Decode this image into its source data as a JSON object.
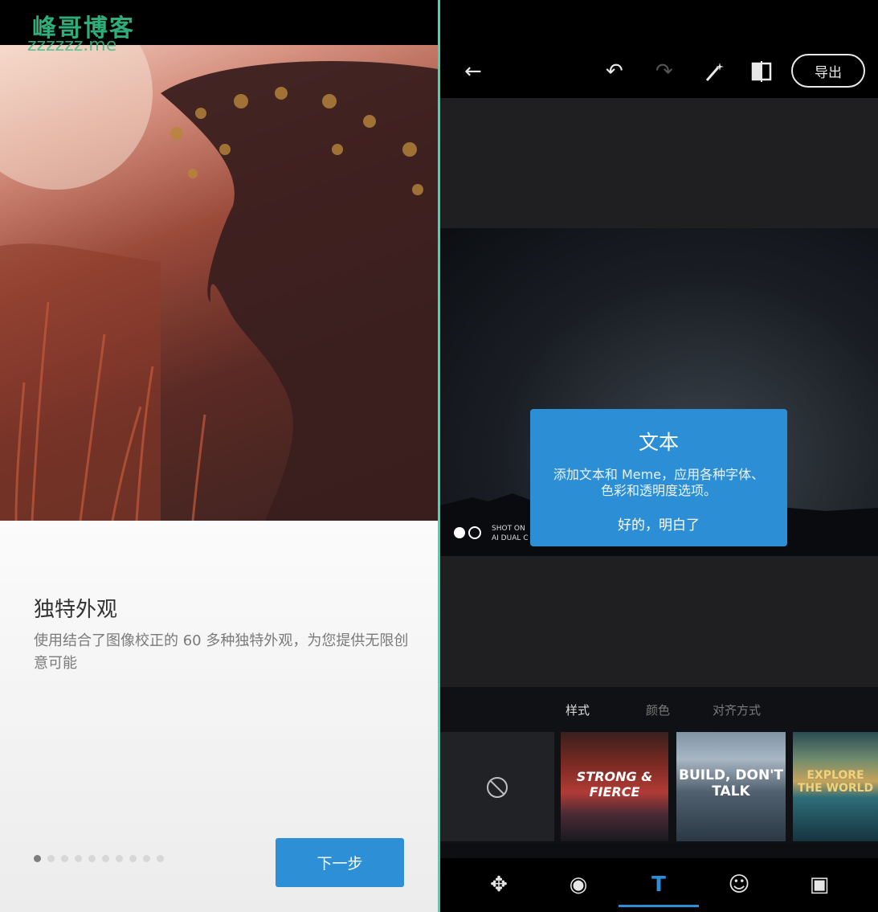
{
  "watermark": {
    "name": "峰哥博客",
    "domain": "zzzzzz.me"
  },
  "left": {
    "title": "独特外观",
    "description": "使用结合了图像校正的 60 多种独特外观，为您提供无限创意可能",
    "page_count": 10,
    "current_page": 1,
    "next_label": "下一步"
  },
  "right": {
    "toolbar": {
      "back_icon": "←",
      "undo_icon": "↶",
      "redo_icon": "↷",
      "magic_icon": "⁄",
      "compare_icon": "◧",
      "export_label": "导出"
    },
    "photo_stamp": [
      "SHOT ON",
      "AI DUAL C"
    ],
    "tooltip": {
      "title": "文本",
      "body": "添加文本和 Meme，应用各种字体、色彩和透明度选项。",
      "ok": "好的，明白了"
    },
    "tabs": [
      {
        "label": "样式",
        "active": true
      },
      {
        "label": "颜色",
        "active": false
      },
      {
        "label": "对齐方式",
        "active": false
      }
    ],
    "thumbnails": [
      {
        "text": "STRONG & FIERCE"
      },
      {
        "text": "BUILD, DON'T TALK"
      },
      {
        "text": "EXPLORE THE WORLD"
      }
    ],
    "bottom_nav": [
      {
        "name": "heal-icon",
        "glyph": "✥",
        "active": false
      },
      {
        "name": "eye-icon",
        "glyph": "◉",
        "active": false
      },
      {
        "name": "text-icon",
        "glyph": "T",
        "active": true
      },
      {
        "name": "sticker-icon",
        "glyph": "☺",
        "active": false
      },
      {
        "name": "frame-icon",
        "glyph": "▣",
        "active": false
      }
    ],
    "accent_color": "#2c8fd6"
  }
}
